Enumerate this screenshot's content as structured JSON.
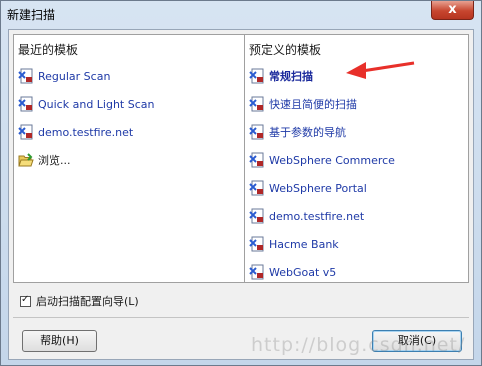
{
  "window": {
    "title": "新建扫描",
    "close_label": "x"
  },
  "left_panel": {
    "heading": "最近的模板",
    "items": [
      {
        "label": "Regular Scan",
        "icon": "scan-template-icon"
      },
      {
        "label": "Quick and Light Scan",
        "icon": "scan-template-icon"
      },
      {
        "label": "demo.testfire.net",
        "icon": "scan-template-icon"
      },
      {
        "label": "浏览...",
        "icon": "open-folder-icon"
      }
    ]
  },
  "right_panel": {
    "heading": "预定义的模板",
    "items": [
      {
        "label": "常规扫描",
        "icon": "scan-template-icon",
        "highlighted": true
      },
      {
        "label": "快速且简便的扫描",
        "icon": "scan-template-icon"
      },
      {
        "label": "基于参数的导航",
        "icon": "scan-template-icon"
      },
      {
        "label": "WebSphere Commerce",
        "icon": "scan-template-icon"
      },
      {
        "label": "WebSphere Portal",
        "icon": "scan-template-icon"
      },
      {
        "label": "demo.testfire.net",
        "icon": "scan-template-icon"
      },
      {
        "label": "Hacme Bank",
        "icon": "scan-template-icon"
      },
      {
        "label": "WebGoat v5",
        "icon": "scan-template-icon"
      }
    ]
  },
  "options": {
    "launch_wizard_label": "启动扫描配置向导(L)",
    "launch_wizard_checked": true
  },
  "buttons": {
    "help_label": "帮助(H)",
    "cancel_label": "取消(C)"
  },
  "watermark": "http://blog.csdn.net/",
  "colors": {
    "link": "#1f3aa7",
    "arrow": "#e8302a",
    "close": "#c7462f"
  }
}
